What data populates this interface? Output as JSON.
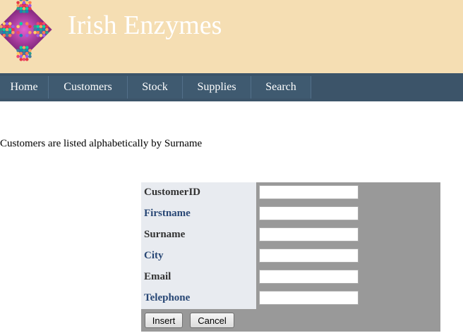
{
  "site": {
    "title": "Irish Enzymes"
  },
  "nav": {
    "items": [
      "Home",
      "Customers",
      "Stock",
      "Supplies",
      "Search"
    ]
  },
  "intro": "Customers are listed alphabetically by Surname",
  "form": {
    "fields": [
      {
        "label": "CustomerID",
        "value": ""
      },
      {
        "label": "Firstname",
        "value": ""
      },
      {
        "label": "Surname",
        "value": ""
      },
      {
        "label": "City",
        "value": ""
      },
      {
        "label": "Email",
        "value": ""
      },
      {
        "label": "Telephone",
        "value": ""
      }
    ],
    "insert_label": "Insert",
    "cancel_label": "Cancel"
  },
  "colors": {
    "header_bg": "#f5deb3",
    "nav_bg": "#3c5469",
    "form_bg": "#999999",
    "label_bg": "#e8ebf0"
  }
}
